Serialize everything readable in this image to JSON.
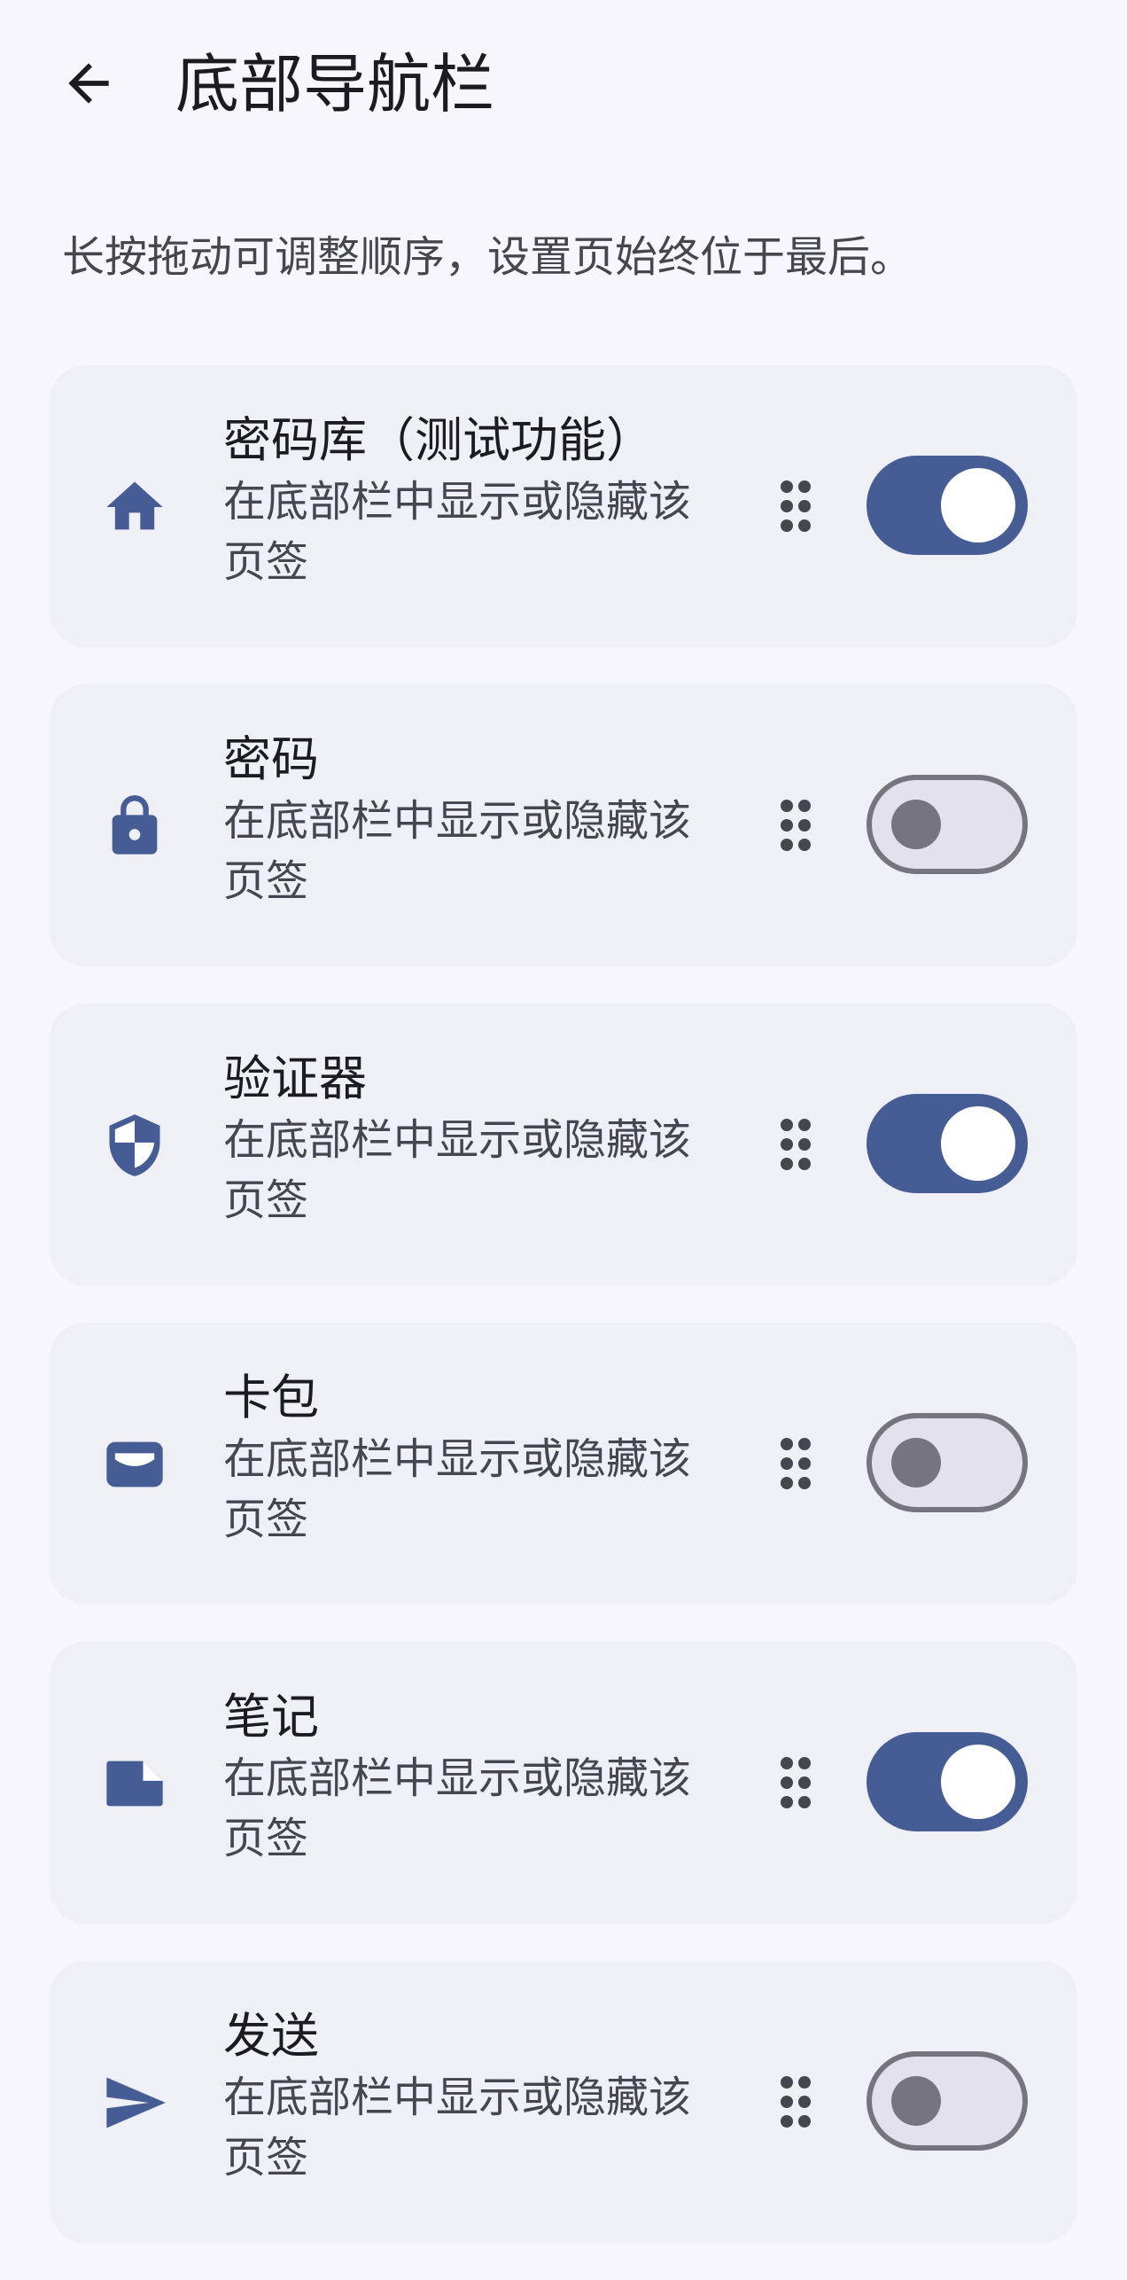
{
  "header": {
    "title": "底部导航栏",
    "back_icon": "arrow-back-icon"
  },
  "description": "长按拖动可调整顺序，设置页始终位于最后。",
  "colors": {
    "accent": "#465c94",
    "card_bg": "#efeff6",
    "page_bg": "#f7f6fc"
  },
  "items": [
    {
      "icon": "home-icon",
      "title": "密码库（测试功能）",
      "subtitle": "在底部栏中显示或隐藏该页签",
      "enabled": true
    },
    {
      "icon": "lock-icon",
      "title": "密码",
      "subtitle": "在底部栏中显示或隐藏该页签",
      "enabled": false
    },
    {
      "icon": "shield-icon",
      "title": "验证器",
      "subtitle": "在底部栏中显示或隐藏该页签",
      "enabled": true
    },
    {
      "icon": "wallet-icon",
      "title": "卡包",
      "subtitle": "在底部栏中显示或隐藏该页签",
      "enabled": false
    },
    {
      "icon": "note-icon",
      "title": "笔记",
      "subtitle": "在底部栏中显示或隐藏该页签",
      "enabled": true
    },
    {
      "icon": "send-icon",
      "title": "发送",
      "subtitle": "在底部栏中显示或隐藏该页签",
      "enabled": false
    }
  ]
}
